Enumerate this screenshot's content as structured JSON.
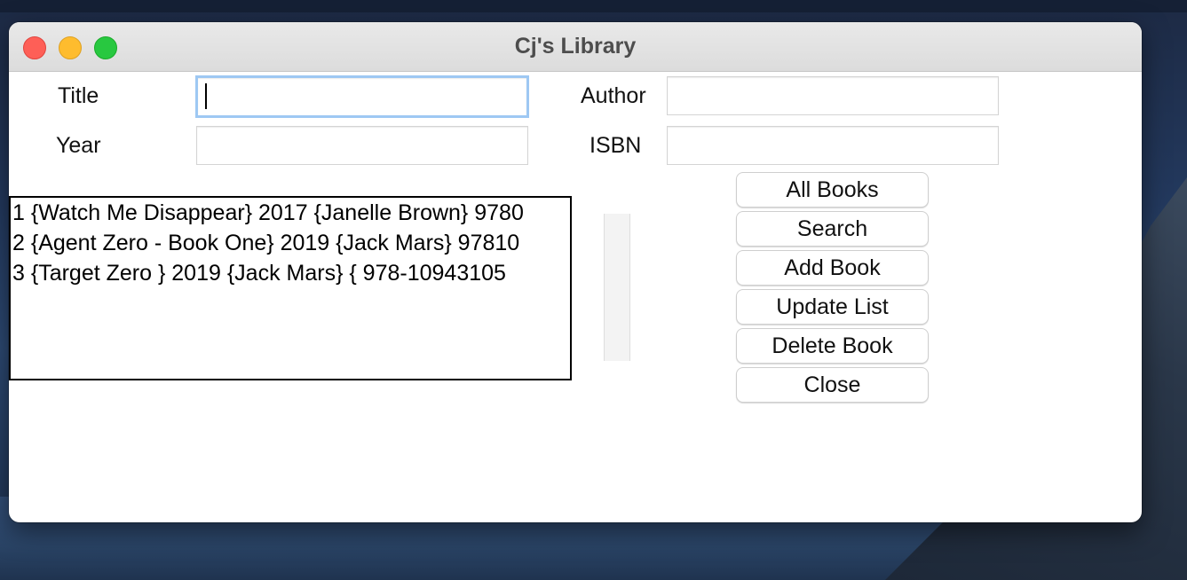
{
  "window": {
    "title": "Cj's Library"
  },
  "form": {
    "title_label": "Title",
    "author_label": "Author",
    "year_label": "Year",
    "isbn_label": "ISBN",
    "title_value": "",
    "author_value": "",
    "year_value": "",
    "isbn_value": ""
  },
  "books": [
    "1 {Watch Me Disappear} 2017 {Janelle Brown} 9780",
    "2 {Agent Zero - Book One} 2019 {Jack Mars} 97810",
    "3 {Target Zero } 2019 {Jack Mars} { 978-10943105"
  ],
  "buttons": {
    "all_books": "All Books",
    "search": "Search",
    "add_book": "Add Book",
    "update_list": "Update List",
    "delete_book": "Delete Book",
    "close": "Close"
  },
  "colors": {
    "close_light": "#fe5f57",
    "minimize_light": "#febc2e",
    "maximize_light": "#28c840",
    "focus_ring": "#9ec8f3"
  }
}
